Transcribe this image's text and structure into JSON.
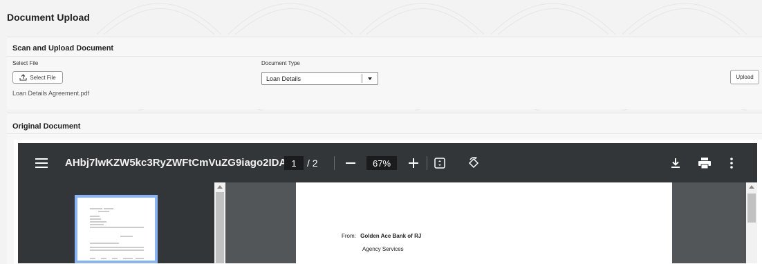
{
  "page": {
    "title": "Document Upload"
  },
  "scan_section": {
    "title": "Scan and Upload Document",
    "select_file_label": "Select File",
    "select_file_button": "Select File",
    "file_name": "Loan Details Agreement.pdf",
    "document_type_label": "Document Type",
    "document_type_value": "Loan Details",
    "upload_button": "Upload"
  },
  "original_section": {
    "title": "Original Document"
  },
  "viewer": {
    "doc_name": "AHbj7lwKZW5kc3RyZWFtCmVuZG9iago2IDAg...",
    "page_current": "1",
    "page_total": "/ 2",
    "zoom": "67%",
    "icons": [
      "menu-icon",
      "zoom-out-icon",
      "zoom-in-icon",
      "fit-page-icon",
      "rotate-icon",
      "download-icon",
      "print-icon",
      "more-icon"
    ],
    "page_from_label": "From:",
    "page_from_value": "Golden Ace Bank of RJ",
    "page_agency": "Agency Services"
  }
}
